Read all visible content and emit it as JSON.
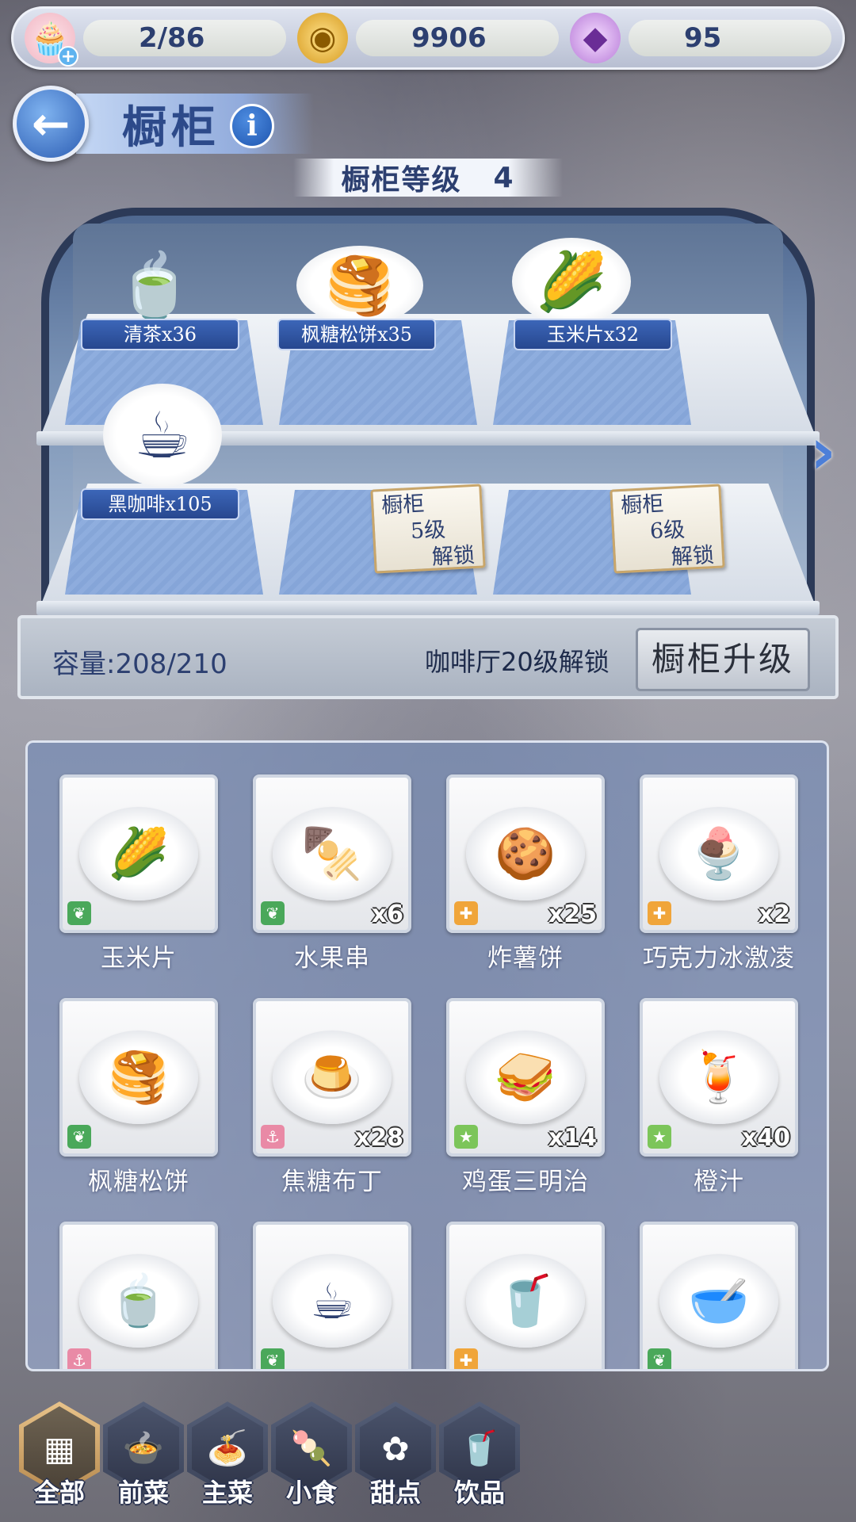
{
  "resources": {
    "stamina": {
      "value": "2/86",
      "icon": "cupcake-icon"
    },
    "coins": {
      "value": "9906",
      "icon": "coin-icon"
    },
    "gems": {
      "value": "95",
      "icon": "gem-icon"
    }
  },
  "header": {
    "title": "橱柜",
    "level_label": "橱柜等级",
    "level_value": "4"
  },
  "cabinet": {
    "shelf_items": [
      {
        "label": "清茶x36",
        "icon": "green-tea"
      },
      {
        "label": "枫糖松饼x35",
        "icon": "maple-pancake"
      },
      {
        "label": "玉米片x32",
        "icon": "corn-chips"
      },
      {
        "label": "黑咖啡x105",
        "icon": "black-coffee"
      }
    ],
    "locked_slots": [
      {
        "line1": "橱柜",
        "line2": "5级",
        "line3": "解锁"
      },
      {
        "line1": "橱柜",
        "line2": "6级",
        "line3": "解锁"
      }
    ],
    "capacity": "容量:208/210",
    "unlock_hint": "咖啡厅20级解锁",
    "upgrade_label": "橱柜升级"
  },
  "items": [
    {
      "name": "玉米片",
      "qty": "",
      "badge": "leaf",
      "badge_color": "#4aa85a",
      "emoji": "🌽"
    },
    {
      "name": "水果串",
      "qty": "x6",
      "badge": "leaf",
      "badge_color": "#4aa85a",
      "emoji": "🍢"
    },
    {
      "name": "炸薯饼",
      "qty": "x25",
      "badge": "puzzle",
      "badge_color": "#f0a53a",
      "emoji": "🍪"
    },
    {
      "name": "巧克力冰激凌",
      "qty": "x2",
      "badge": "puzzle",
      "badge_color": "#f0a53a",
      "emoji": "🍨"
    },
    {
      "name": "枫糖松饼",
      "qty": "",
      "badge": "leaf",
      "badge_color": "#4aa85a",
      "emoji": "🥞"
    },
    {
      "name": "焦糖布丁",
      "qty": "x28",
      "badge": "anchor",
      "badge_color": "#e98aa6",
      "emoji": "🍮"
    },
    {
      "name": "鸡蛋三明治",
      "qty": "x14",
      "badge": "star",
      "badge_color": "#7cc55a",
      "emoji": "🥪"
    },
    {
      "name": "橙汁",
      "qty": "x40",
      "badge": "star",
      "badge_color": "#7cc55a",
      "emoji": "🍹"
    },
    {
      "name": "",
      "qty": "",
      "badge": "anchor",
      "badge_color": "#e98aa6",
      "emoji": "🍵"
    },
    {
      "name": "",
      "qty": "",
      "badge": "leaf",
      "badge_color": "#4aa85a",
      "emoji": "☕"
    },
    {
      "name": "",
      "qty": "",
      "badge": "puzzle",
      "badge_color": "#f0a53a",
      "emoji": "🥤"
    },
    {
      "name": "",
      "qty": "",
      "badge": "leaf",
      "badge_color": "#4aa85a",
      "emoji": "🥣"
    }
  ],
  "tabs": [
    {
      "label": "全部",
      "icon": "grid-icon",
      "active": true
    },
    {
      "label": "前菜",
      "icon": "appetizer-icon",
      "active": false
    },
    {
      "label": "主菜",
      "icon": "main-course-icon",
      "active": false
    },
    {
      "label": "小食",
      "icon": "snack-icon",
      "active": false
    },
    {
      "label": "甜点",
      "icon": "dessert-icon",
      "active": false
    },
    {
      "label": "饮品",
      "icon": "drink-icon",
      "active": false
    }
  ]
}
